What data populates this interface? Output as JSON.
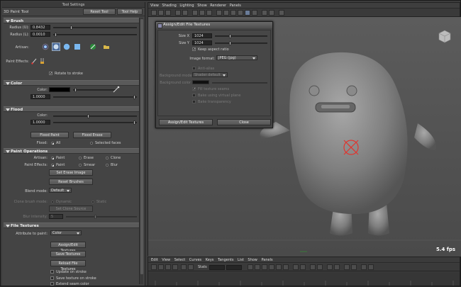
{
  "tool_panel": {
    "window_title": "Tool Settings",
    "tool_name": "3D Paint Tool",
    "reset_label": "Reset Tool",
    "help_label": "Tool Help"
  },
  "brush": {
    "section_label": "Brush",
    "radius_u_label": "Radius (U):",
    "radius_u_value": "0.8432",
    "radius_l_label": "Radius (L):",
    "radius_l_value": "0.0010",
    "artisan_label": "Artisan:",
    "paint_effects_label": "Paint Effects:",
    "rotate_label": "Rotate to stroke"
  },
  "color": {
    "section_label": "Color",
    "color_label": "Color:",
    "opacity_label": "Opacity:",
    "opacity_value": "1.0000",
    "swatch": "#000000"
  },
  "flood": {
    "section_label": "Flood",
    "color_label": "Color:",
    "opacity_label": "Opacity:",
    "opacity_value": "1.0000",
    "flood_paint": "Flood Paint",
    "flood_erase": "Flood Erase",
    "flood_label": "Flood:",
    "all_label": "All",
    "selected_faces_label": "Selected faces"
  },
  "paint_ops": {
    "section_label": "Paint Operations",
    "artisan_label": "Artisan:",
    "paint": "Paint",
    "erase": "Erase",
    "clone": "Clone",
    "paint_effects_label": "Paint Effects:",
    "pe_paint": "Paint",
    "smear": "Smear",
    "blur": "Blur",
    "set_erase_image": "Set Erase Image",
    "reset_brushes": "Reset Brushes",
    "blend_mode_label": "Blend mode:",
    "blend_mode_value": "Default",
    "clone_mode_label": "Clone brush mode:",
    "dynamic": "Dynamic",
    "static": "Static",
    "set_clone_source": "Set Clone Source",
    "blur_intensity_label": "Blur intensity:",
    "blur_intensity_value": "5"
  },
  "file_textures": {
    "section_label": "File Textures",
    "attribute_label": "Attribute to paint:",
    "attribute_value": "Color",
    "assign_edit": "Assign/Edit Textures",
    "save_textures": "Save Textures",
    "reload": "Reload File Textures",
    "update_on_stroke": "Update on stroke",
    "save_on_stroke": "Save texture on stroke",
    "extend_seam": "Extend seam color"
  },
  "viewport": {
    "menu": [
      "View",
      "Shading",
      "Lighting",
      "Show",
      "Renderer",
      "Panels"
    ],
    "fps": "5.4 fps"
  },
  "dialog": {
    "title": "Assign/Edit File Textures",
    "size_x_label": "Size X",
    "size_x_value": "1024",
    "size_y_label": "Size Y",
    "size_y_value": "1024",
    "keep_aspect": "Keep aspect ratio",
    "image_format_label": "Image format:",
    "image_format_value": "JPEG (jpg)",
    "anti_alias": "Anti-alias",
    "background_mode_label": "Background mode:",
    "background_mode_value": "Shader default",
    "background_color_label": "Background color",
    "fill_seams": "Fill texture seams",
    "bake_lighting": "Bake using virtual plane",
    "bake_transparency": "Bake transparency",
    "assign_button": "Assign/Edit Textures",
    "close_button": "Close"
  },
  "graph": {
    "menu": [
      "Edit",
      "View",
      "Select",
      "Curves",
      "Keys",
      "Tangents",
      "List",
      "Show",
      "Panels"
    ],
    "stats_label": "Stats"
  }
}
